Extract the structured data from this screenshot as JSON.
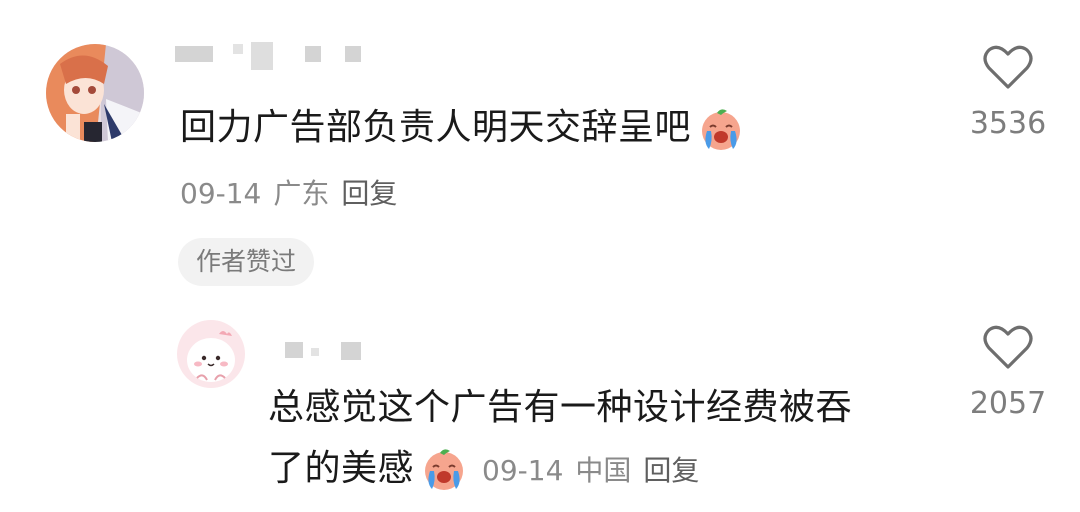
{
  "comment": {
    "text": "回力广告部负责人明天交辞呈吧",
    "emoji_icon": "crying-face-emoji",
    "date": "09-14",
    "location": "广东",
    "reply_label": "回复",
    "author_liked_badge": "作者赞过",
    "like_count": "3536",
    "avatar_icon": "anime-girl-avatar"
  },
  "reply": {
    "text_line1": "总感觉这个广告有一种设计经费被吞",
    "text_line2": "了的美感",
    "emoji_icon": "crying-face-emoji",
    "date": "09-14",
    "location": "中国",
    "reply_label": "回复",
    "like_count": "2057",
    "avatar_icon": "cartoon-pink-creature-avatar"
  },
  "icons": {
    "like": "heart-outline-icon"
  },
  "colors": {
    "text_primary": "#1a1a1a",
    "text_secondary": "#8a8a8a",
    "badge_bg": "#f2f2f2",
    "emoji_face": "#f6a58e",
    "emoji_tear": "#4a9be8"
  }
}
